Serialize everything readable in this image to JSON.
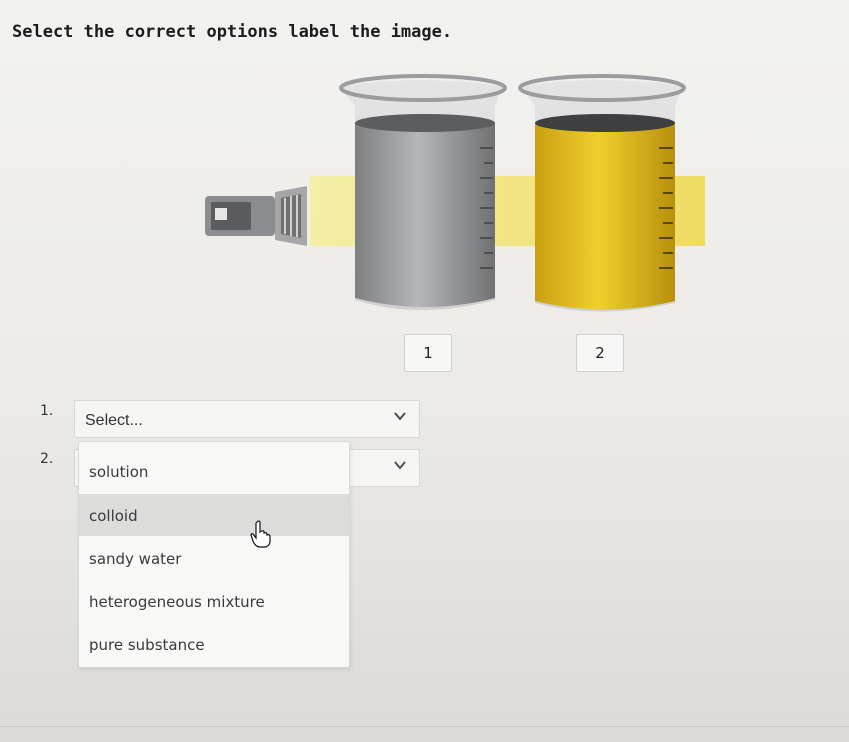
{
  "question": {
    "title": "Select the correct options label the image."
  },
  "figure": {
    "labels": [
      "1",
      "2"
    ],
    "colors": {
      "grey_liquid": "#9a9c9e",
      "yellow_liquid": "#e8c21a",
      "beam": "#f2e25a"
    }
  },
  "dropdowns": [
    {
      "number": "1.",
      "value": "Select..."
    },
    {
      "number": "2.",
      "value": ""
    }
  ],
  "menu": {
    "options": [
      "solution",
      "colloid",
      "sandy water",
      "heterogeneous mixture",
      "pure substance"
    ],
    "highlighted": "colloid"
  },
  "icons": {
    "chevron": "chevron-down-icon",
    "cursor": "hand-pointer-icon",
    "flashlight": "flashlight-icon"
  }
}
